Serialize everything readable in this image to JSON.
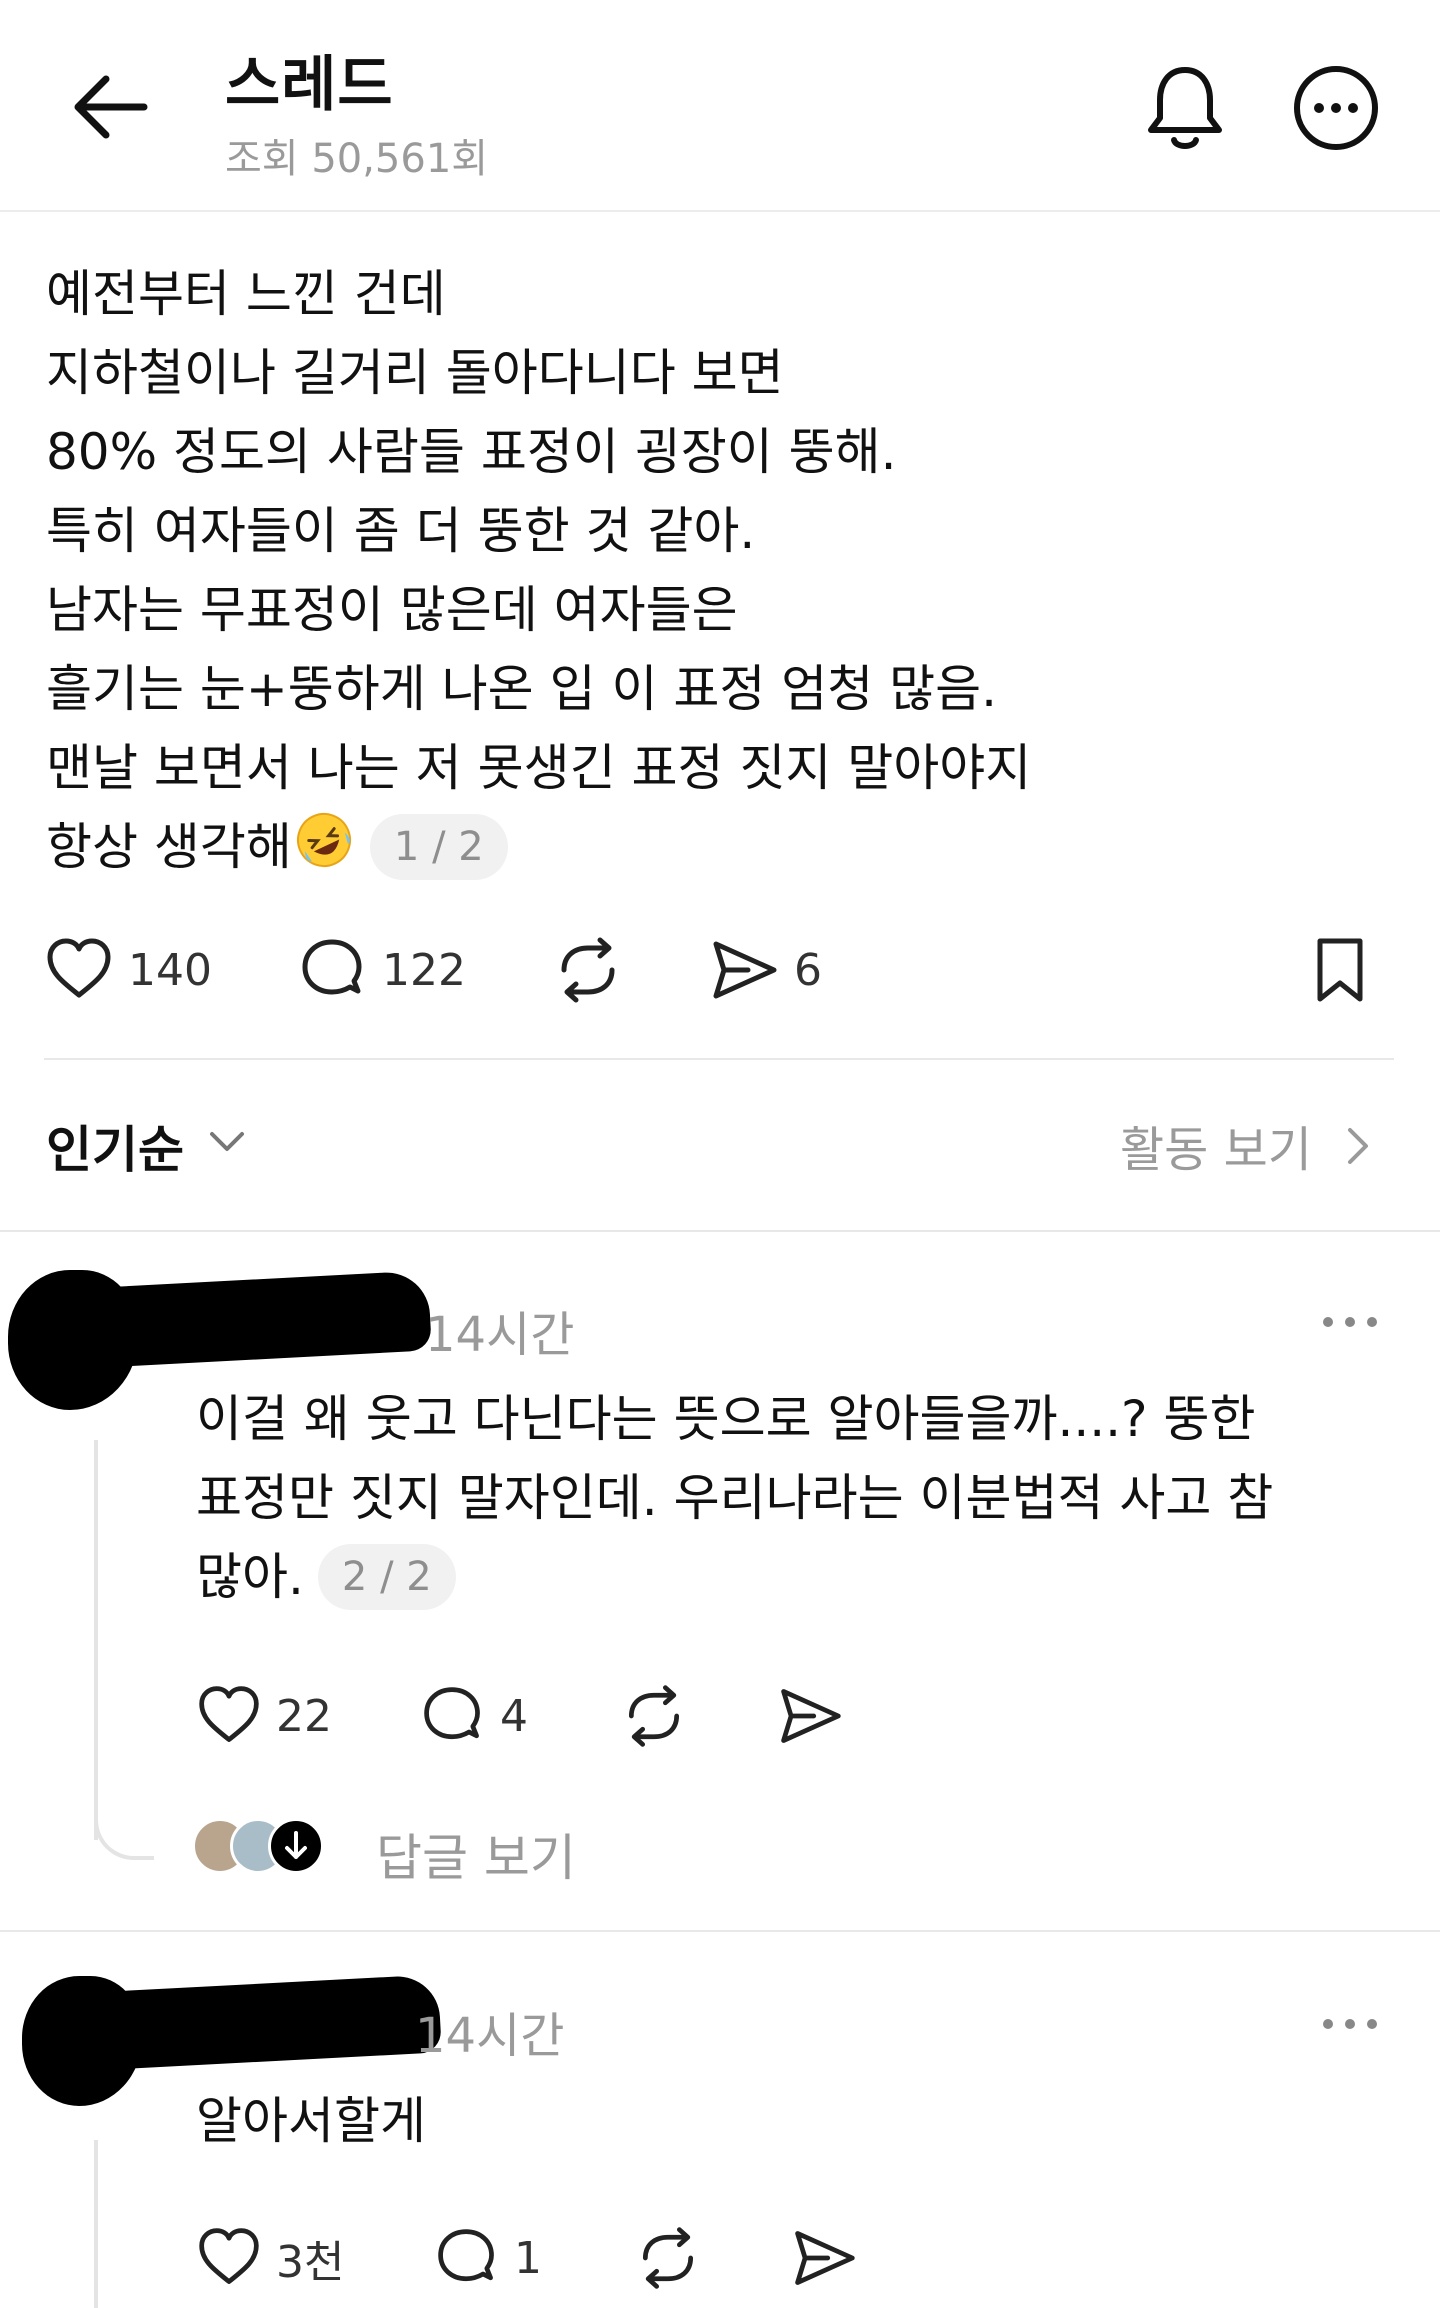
{
  "header": {
    "title": "스레드",
    "views": "조회 50,561회"
  },
  "post": {
    "lines": [
      "예전부터 느낀 건데",
      "지하철이나 길거리 돌아다니다 보면",
      "80% 정도의 사람들 표정이 굉장이 뚱해.",
      "특히 여자들이 좀 더 뚱한 것 같아.",
      "남자는 무표정이 많은데 여자들은",
      "흘기는 눈+뚱하게 나온 입 이 표정 엄청 많음.",
      "맨날 보면서 나는 저 못생긴 표정 짓지 말아야지",
      "항상 생각해"
    ],
    "page_indicator": "1 / 2",
    "likes": "140",
    "comments": "122",
    "shares": "6"
  },
  "sort": {
    "label": "인기순",
    "activity_link": "활동 보기"
  },
  "comments": [
    {
      "time": "14시간",
      "lines": [
        "이걸 왜 웃고 다닌다는 뜻으로 알아들을까....? 뚱한",
        "표정만 짓지 말자인데. 우리나라는 이분법적 사고 참",
        "많아."
      ],
      "page_indicator": "2 / 2",
      "likes": "22",
      "comments": "4",
      "view_replies": "답글 보기"
    },
    {
      "time": "14시간",
      "lines": [
        "알아서할게"
      ],
      "likes": "3천",
      "comments": "1"
    }
  ],
  "colors": {
    "text": "#111111",
    "muted": "#9a9a9a",
    "divider": "#e8e8e8",
    "pill_bg": "#f1f1f1"
  },
  "icons": [
    "back-arrow-icon",
    "bell-icon",
    "more-icon",
    "heart-icon",
    "comment-icon",
    "repost-icon",
    "send-icon",
    "bookmark-icon",
    "chevron-down-icon",
    "chevron-right-icon",
    "ellipsis-icon",
    "emoji-rofl-icon"
  ]
}
